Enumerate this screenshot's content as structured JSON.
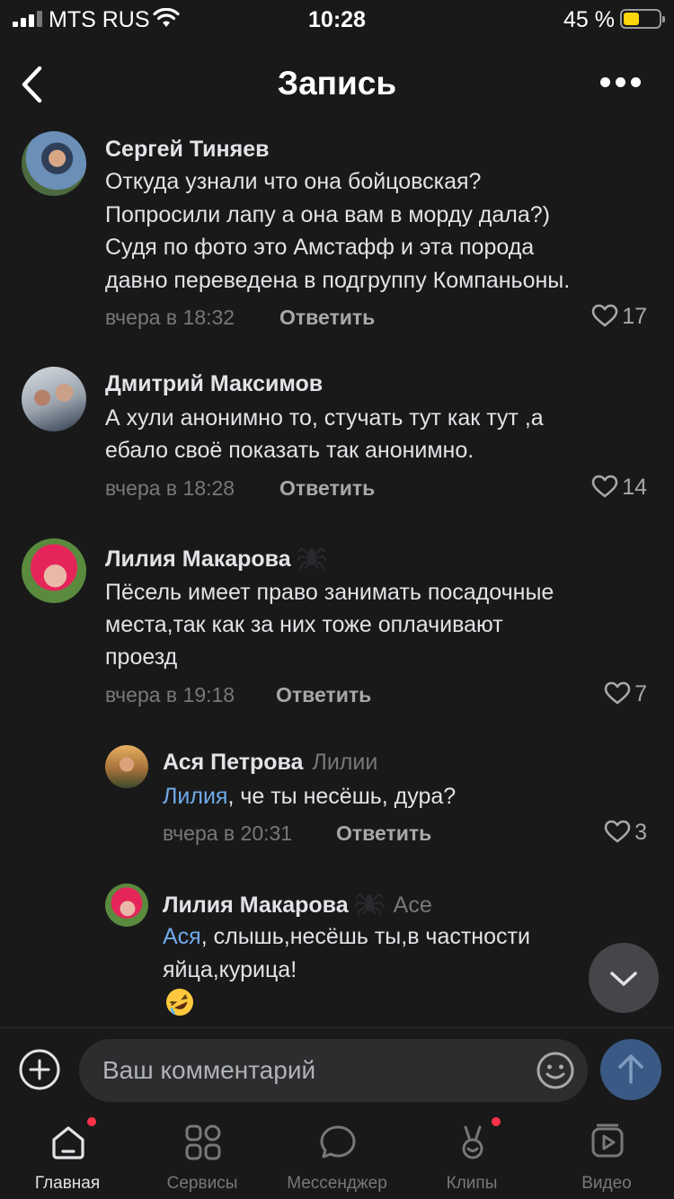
{
  "status_bar": {
    "carrier": "MTS RUS",
    "time": "10:28",
    "battery_percent": "45 %",
    "battery_level": 0.45
  },
  "header": {
    "title": "Запись"
  },
  "comments": [
    {
      "author": "Сергей Тиняев",
      "lines": [
        "Откуда узнали что она бойцовская?",
        "Попросили лапу а она вам в морду дала?)",
        "Судя по фото это Амстафф и эта порода",
        "давно переведена в подгруппу Компаньоны."
      ],
      "time": "вчера в 18:32",
      "reply_label": "Ответить",
      "likes": "17"
    },
    {
      "author": "Дмитрий Максимов",
      "lines": [
        "А хули анонимно то,  стучать тут как тут ,а",
        "ебало своё показать так анонимно."
      ],
      "time": "вчера в 18:28",
      "reply_label": "Ответить",
      "likes": "14"
    },
    {
      "author": "Лилия Макарова",
      "lines": [
        "Пёсель имеет право занимать посадочные",
        "места,так как за них тоже оплачивают",
        "проезд"
      ],
      "time": "вчера в 19:18",
      "reply_label": "Ответить",
      "likes": "7"
    },
    {
      "author": "Ася Петрова",
      "reply_to": "Лилии",
      "mention": "Лилия",
      "lines": [
        ", че ты несёшь, дура?"
      ],
      "time": "вчера в 20:31",
      "reply_label": "Ответить",
      "likes": "3"
    },
    {
      "author": "Лилия Макарова",
      "reply_to": "Асе",
      "mention": "Ася",
      "lines": [
        ", слышь,несёшь ты,в частности",
        "яйца,курица!"
      ],
      "emoji": "rolling-on-floor-laughing"
    }
  ],
  "composer": {
    "placeholder": "Ваш комментарий"
  },
  "tabbar": {
    "tabs": [
      {
        "label": "Главная",
        "icon": "home-icon",
        "active": true,
        "badge": true
      },
      {
        "label": "Сервисы",
        "icon": "services-icon",
        "active": false,
        "badge": false
      },
      {
        "label": "Мессенджер",
        "icon": "messenger-icon",
        "active": false,
        "badge": false
      },
      {
        "label": "Клипы",
        "icon": "clips-icon",
        "active": false,
        "badge": true
      },
      {
        "label": "Видео",
        "icon": "video-icon",
        "active": false,
        "badge": false
      }
    ]
  },
  "colors": {
    "background": "#19191a",
    "mention": "#71aaeb",
    "secondary_text": "#76787a",
    "badge": "#ff3347",
    "send_button": "#3a5a85"
  }
}
